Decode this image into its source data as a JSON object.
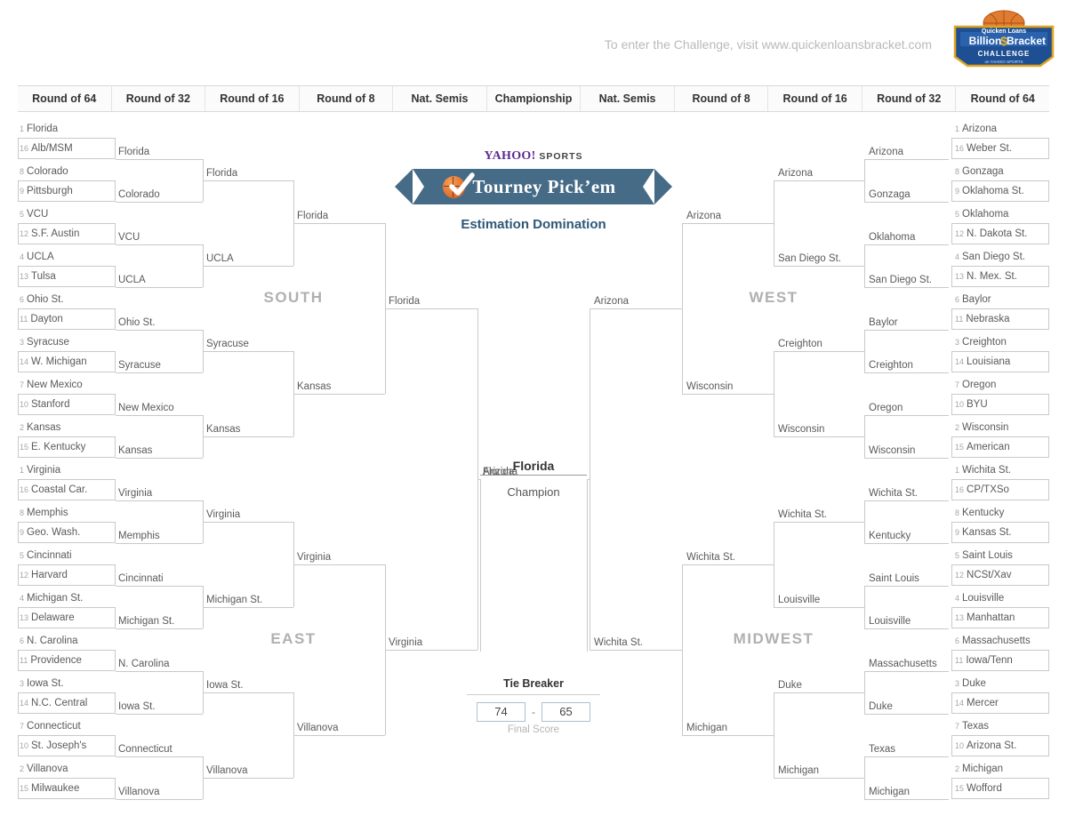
{
  "header": {
    "promo_text": "To enter the Challenge, visit www.quickenloansbracket.com",
    "logo": {
      "brand": "Quicken Loans",
      "line1": "Billion",
      "dollar": "$",
      "line2": "Bracket",
      "line3": "CHALLENGE",
      "line4": "on YAHOO! SPORTS"
    }
  },
  "rounds": [
    "Round of 64",
    "Round of 32",
    "Round of 16",
    "Round of 8",
    "Nat. Semis",
    "Championship",
    "Nat. Semis",
    "Round of 8",
    "Round of 16",
    "Round of 32",
    "Round of 64"
  ],
  "logo": {
    "yahoo": "YAHOO!",
    "sports": "SPORTS",
    "title": "Tourney Pick’em",
    "group_name": "Estimation Domination"
  },
  "regions": {
    "south": "SOUTH",
    "east": "EAST",
    "west": "WEST",
    "midwest": "MIDWEST"
  },
  "champion": {
    "name": "Florida",
    "label": "Champion"
  },
  "tiebreaker": {
    "title": "Tie Breaker",
    "score_left": "74",
    "dash": "-",
    "score_right": "65",
    "caption": "Final Score"
  },
  "chart_data": {
    "type": "bracket",
    "title": "Tourney Pick'em — Estimation Domination",
    "champion": "Florida",
    "finalists": [
      "Florida",
      "Arizona"
    ],
    "final_four": [
      "Florida",
      "Virginia",
      "Arizona",
      "Wichita St."
    ],
    "elite_eight": [
      "Florida",
      "Virginia",
      "Arizona",
      "Wichita St."
    ],
    "regions": [
      {
        "name": "SOUTH",
        "side": "left",
        "round_of_64": [
          {
            "seed": "1",
            "team": "Florida"
          },
          {
            "seed": "16",
            "team": "Alb/MSM"
          },
          {
            "seed": "8",
            "team": "Colorado"
          },
          {
            "seed": "9",
            "team": "Pittsburgh"
          },
          {
            "seed": "5",
            "team": "VCU"
          },
          {
            "seed": "12",
            "team": "S.F. Austin"
          },
          {
            "seed": "4",
            "team": "UCLA"
          },
          {
            "seed": "13",
            "team": "Tulsa"
          },
          {
            "seed": "6",
            "team": "Ohio St."
          },
          {
            "seed": "11",
            "team": "Dayton"
          },
          {
            "seed": "3",
            "team": "Syracuse"
          },
          {
            "seed": "14",
            "team": "W. Michigan"
          },
          {
            "seed": "7",
            "team": "New Mexico"
          },
          {
            "seed": "10",
            "team": "Stanford"
          },
          {
            "seed": "2",
            "team": "Kansas"
          },
          {
            "seed": "15",
            "team": "E. Kentucky"
          }
        ],
        "round_of_32": [
          "Florida",
          "Colorado",
          "VCU",
          "UCLA",
          "Ohio St.",
          "Syracuse",
          "New Mexico",
          "Kansas"
        ],
        "round_of_16": [
          "Florida",
          "UCLA",
          "Syracuse",
          "Kansas"
        ],
        "round_of_8": [
          "Florida",
          "Kansas"
        ],
        "regional_champ": "Florida"
      },
      {
        "name": "EAST",
        "side": "left",
        "round_of_64": [
          {
            "seed": "1",
            "team": "Virginia"
          },
          {
            "seed": "16",
            "team": "Coastal Car."
          },
          {
            "seed": "8",
            "team": "Memphis"
          },
          {
            "seed": "9",
            "team": "Geo. Wash."
          },
          {
            "seed": "5",
            "team": "Cincinnati"
          },
          {
            "seed": "12",
            "team": "Harvard"
          },
          {
            "seed": "4",
            "team": "Michigan St."
          },
          {
            "seed": "13",
            "team": "Delaware"
          },
          {
            "seed": "6",
            "team": "N. Carolina"
          },
          {
            "seed": "11",
            "team": "Providence"
          },
          {
            "seed": "3",
            "team": "Iowa St."
          },
          {
            "seed": "14",
            "team": "N.C. Central"
          },
          {
            "seed": "7",
            "team": "Connecticut"
          },
          {
            "seed": "10",
            "team": "St. Joseph's"
          },
          {
            "seed": "2",
            "team": "Villanova"
          },
          {
            "seed": "15",
            "team": "Milwaukee"
          }
        ],
        "round_of_32": [
          "Virginia",
          "Memphis",
          "Cincinnati",
          "Michigan St.",
          "N. Carolina",
          "Iowa St.",
          "Connecticut",
          "Villanova"
        ],
        "round_of_16": [
          "Virginia",
          "Michigan St.",
          "Iowa St.",
          "Villanova"
        ],
        "round_of_8": [
          "Virginia",
          "Villanova"
        ],
        "regional_champ": "Virginia"
      },
      {
        "name": "WEST",
        "side": "right",
        "round_of_64": [
          {
            "seed": "1",
            "team": "Arizona"
          },
          {
            "seed": "16",
            "team": "Weber St."
          },
          {
            "seed": "8",
            "team": "Gonzaga"
          },
          {
            "seed": "9",
            "team": "Oklahoma St."
          },
          {
            "seed": "5",
            "team": "Oklahoma"
          },
          {
            "seed": "12",
            "team": "N. Dakota St."
          },
          {
            "seed": "4",
            "team": "San Diego St."
          },
          {
            "seed": "13",
            "team": "N. Mex. St."
          },
          {
            "seed": "6",
            "team": "Baylor"
          },
          {
            "seed": "11",
            "team": "Nebraska"
          },
          {
            "seed": "3",
            "team": "Creighton"
          },
          {
            "seed": "14",
            "team": "Louisiana"
          },
          {
            "seed": "7",
            "team": "Oregon"
          },
          {
            "seed": "10",
            "team": "BYU"
          },
          {
            "seed": "2",
            "team": "Wisconsin"
          },
          {
            "seed": "15",
            "team": "American"
          }
        ],
        "round_of_32": [
          "Arizona",
          "Gonzaga",
          "Oklahoma",
          "San Diego St.",
          "Baylor",
          "Creighton",
          "Oregon",
          "Wisconsin"
        ],
        "round_of_16": [
          "Arizona",
          "San Diego St.",
          "Creighton",
          "Wisconsin"
        ],
        "round_of_8": [
          "Arizona",
          "Wisconsin"
        ],
        "regional_champ": "Arizona"
      },
      {
        "name": "MIDWEST",
        "side": "right",
        "round_of_64": [
          {
            "seed": "1",
            "team": "Wichita St."
          },
          {
            "seed": "16",
            "team": "CP/TXSo"
          },
          {
            "seed": "8",
            "team": "Kentucky"
          },
          {
            "seed": "9",
            "team": "Kansas St."
          },
          {
            "seed": "5",
            "team": "Saint Louis"
          },
          {
            "seed": "12",
            "team": "NCSt/Xav"
          },
          {
            "seed": "4",
            "team": "Louisville"
          },
          {
            "seed": "13",
            "team": "Manhattan"
          },
          {
            "seed": "6",
            "team": "Massachusetts"
          },
          {
            "seed": "11",
            "team": "Iowa/Tenn"
          },
          {
            "seed": "3",
            "team": "Duke"
          },
          {
            "seed": "14",
            "team": "Mercer"
          },
          {
            "seed": "7",
            "team": "Texas"
          },
          {
            "seed": "10",
            "team": "Arizona St."
          },
          {
            "seed": "2",
            "team": "Michigan"
          },
          {
            "seed": "15",
            "team": "Wofford"
          }
        ],
        "round_of_32": [
          "Wichita St.",
          "Kentucky",
          "Saint Louis",
          "Louisville",
          "Massachusetts",
          "Duke",
          "Texas",
          "Michigan"
        ],
        "round_of_16": [
          "Wichita St.",
          "Louisville",
          "Duke",
          "Michigan"
        ],
        "round_of_8": [
          "Wichita St.",
          "Michigan"
        ],
        "regional_champ": "Wichita St."
      }
    ],
    "national_semis": {
      "left_top": "Florida",
      "left_bottom": "Virginia",
      "right_top": "Arizona",
      "right_bottom": "Wichita St."
    },
    "championship": {
      "top": "Florida",
      "bottom": "Arizona"
    },
    "tiebreaker_score": [
      74,
      65
    ]
  }
}
